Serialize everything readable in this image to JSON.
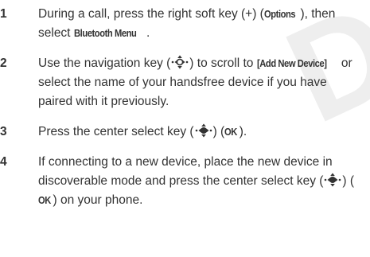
{
  "page": {
    "steps": [
      {
        "number": "1",
        "text_a": "During a call, press the right soft key (+) (",
        "term_a": "Options",
        "text_b": "), then select ",
        "term_b": "Bluetooth Menu",
        "text_c": "."
      },
      {
        "number": "2",
        "text_a": "Use the navigation key (",
        "icon": "navigation-key-icon",
        "text_b": ") to scroll to ",
        "term_a": "[Add New Device]",
        "text_c": " or select the name of your handsfree device if you have paired with it previously."
      },
      {
        "number": "3",
        "text_a": "Press the center select key (",
        "icon": "center-select-key-icon",
        "text_b": ") (",
        "term_a": "OK",
        "text_c": ")."
      },
      {
        "number": "4",
        "text_a": "If connecting to a new device, place the new device in discoverable mode and press the center select key (",
        "icon": "center-select-key-icon",
        "text_b": ") (",
        "term_a": "OK",
        "text_c": ") on your phone."
      }
    ]
  }
}
